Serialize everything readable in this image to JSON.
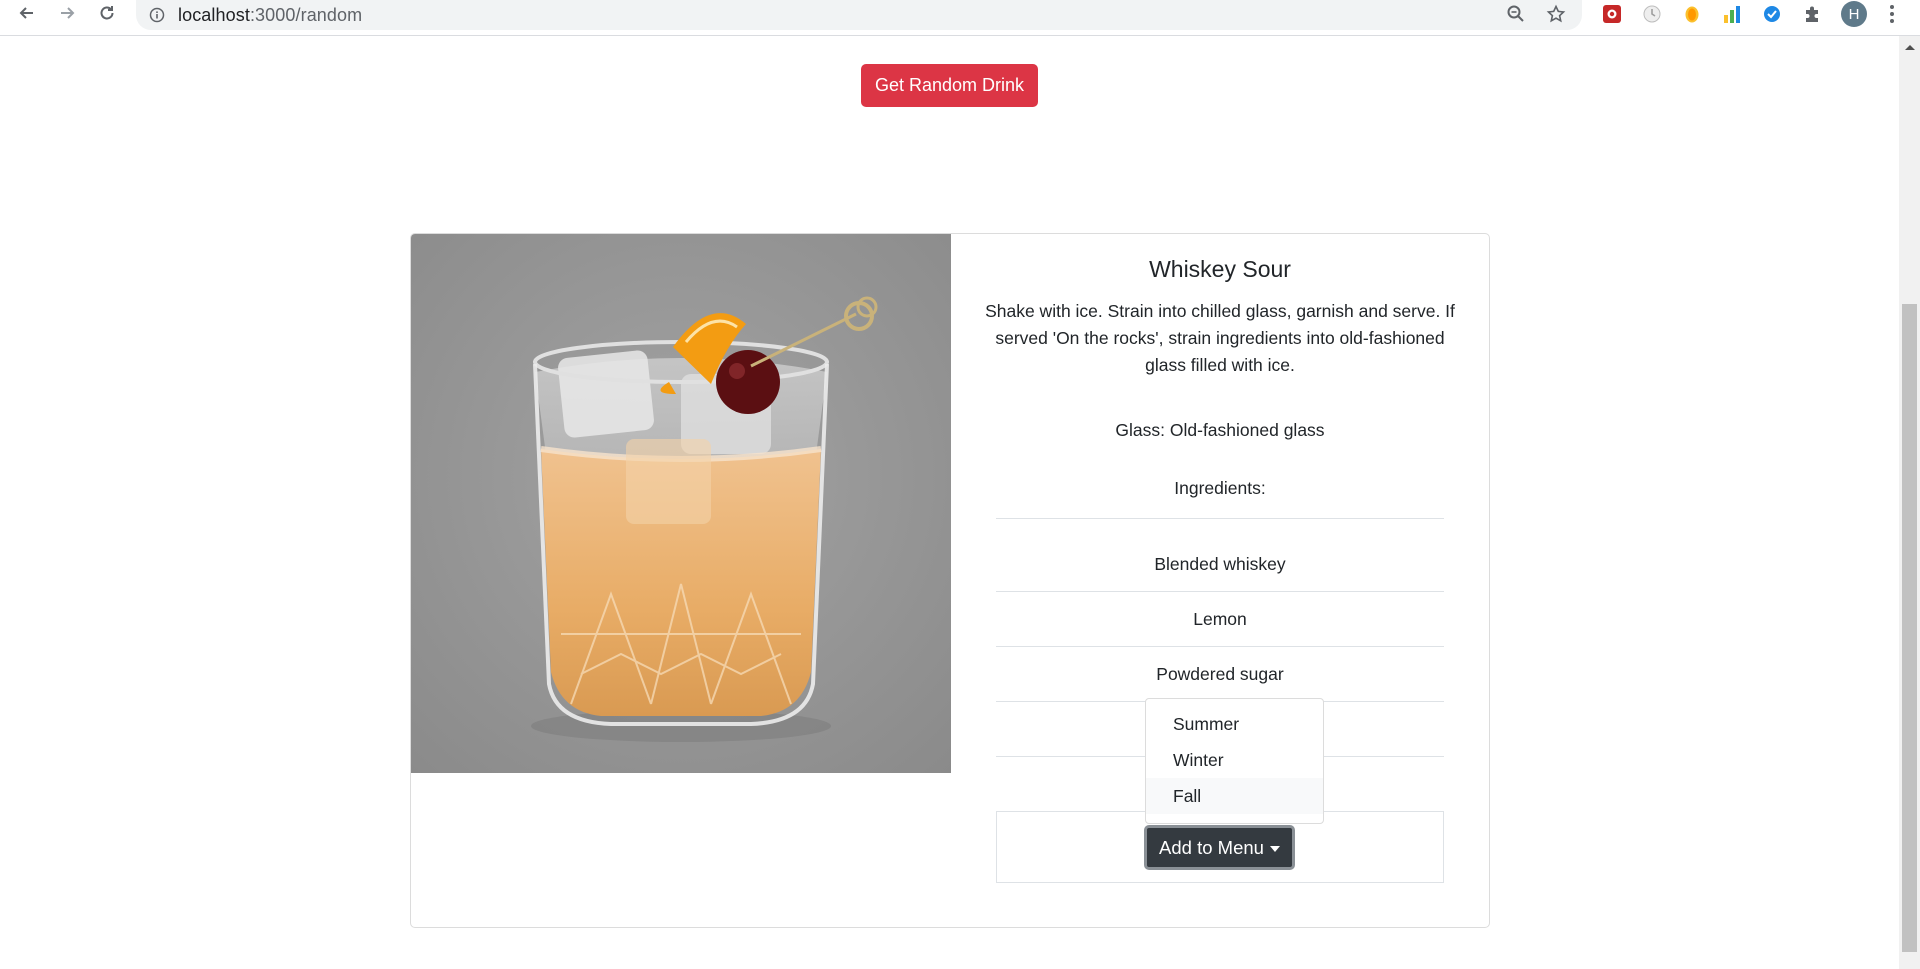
{
  "browser": {
    "url_host": "localhost",
    "url_path": ":3000/random",
    "profile_initial": "H"
  },
  "page": {
    "random_button_label": "Get Random Drink"
  },
  "drink": {
    "name": "Whiskey Sour",
    "instructions": "Shake with ice. Strain into chilled glass, garnish and serve. If served 'On the rocks', strain ingredients into old-fashioned glass filled with ice.",
    "glass": "Glass: Old-fashioned glass",
    "ingredients_label": "Ingredients:",
    "ingredients": [
      "Blended whiskey",
      "Lemon",
      "Powdered sugar",
      "",
      ""
    ]
  },
  "add_menu": {
    "label": "Add to Menu",
    "options": [
      "Summer",
      "Winter",
      "Fall"
    ],
    "hovered_option": "Fall"
  },
  "colors": {
    "danger": "#dc3545",
    "dark": "#343a40"
  }
}
